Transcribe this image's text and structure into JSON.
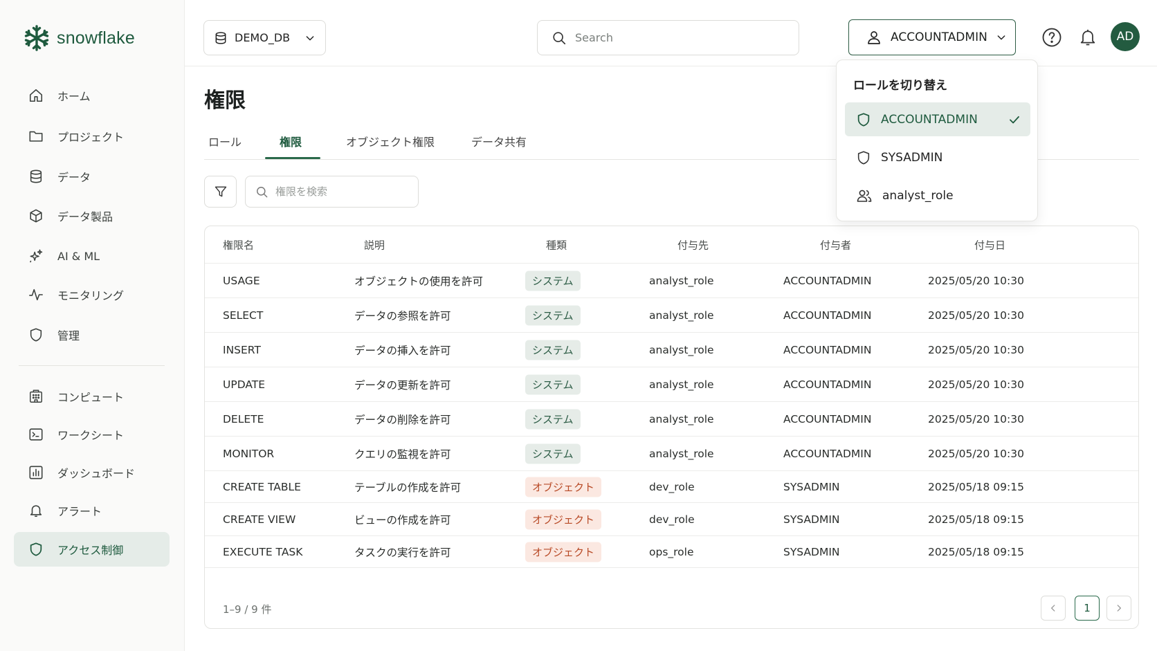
{
  "brand": {
    "name": "snowflake",
    "color": "#29b5e8"
  },
  "colors": {
    "accent": "#1e5a3e",
    "system_badge": "#e6ece8",
    "object_badge": "#fbe8e1"
  },
  "sidebar": {
    "items": [
      {
        "label": "ホーム",
        "icon": "home-icon"
      },
      {
        "label": "プロジェクト",
        "icon": "folder-icon"
      },
      {
        "label": "データ",
        "icon": "database-icon"
      },
      {
        "label": "データ製品",
        "icon": "cube-icon"
      },
      {
        "label": "AI & ML",
        "icon": "sparkle-icon"
      },
      {
        "label": "モニタリング",
        "icon": "activity-icon"
      },
      {
        "label": "管理",
        "icon": "shield-icon"
      },
      {
        "label": "コンピュート",
        "icon": "building-icon"
      },
      {
        "label": "ワークシート",
        "icon": "terminal-icon"
      },
      {
        "label": "ダッシュボード",
        "icon": "chart-icon"
      },
      {
        "label": "アラート",
        "icon": "bell-icon"
      },
      {
        "label": "アクセス制御",
        "icon": "shield-icon",
        "active": true
      }
    ]
  },
  "header": {
    "database": "DEMO_DB",
    "search_placeholder": "Search",
    "role": "ACCOUNTADMIN",
    "avatar_initials": "AD"
  },
  "role_menu": {
    "title": "ロールを切り替え",
    "items": [
      {
        "label": "ACCOUNTADMIN",
        "icon": "shield-icon",
        "selected": true
      },
      {
        "label": "SYSADMIN",
        "icon": "shield-icon",
        "selected": false
      },
      {
        "label": "analyst_role",
        "icon": "users-icon",
        "selected": false
      }
    ]
  },
  "main": {
    "title": "権限",
    "tabs": [
      "ロール",
      "権限",
      "オブジェクト権限",
      "データ共有"
    ],
    "active_tab": "権限",
    "search_placeholder": "権限を検索"
  },
  "table": {
    "columns": [
      "権限名",
      "説明",
      "種類",
      "付与先",
      "付与者",
      "付与日"
    ],
    "rows": [
      [
        "USAGE",
        "オブジェクトの使用を許可",
        "システム",
        "analyst_role",
        "ACCOUNTADMIN",
        "2025/05/20 10:30"
      ],
      [
        "SELECT",
        "データの参照を許可",
        "システム",
        "analyst_role",
        "ACCOUNTADMIN",
        "2025/05/20 10:30"
      ],
      [
        "INSERT",
        "データの挿入を許可",
        "システム",
        "analyst_role",
        "ACCOUNTADMIN",
        "2025/05/20 10:30"
      ],
      [
        "UPDATE",
        "データの更新を許可",
        "システム",
        "analyst_role",
        "ACCOUNTADMIN",
        "2025/05/20 10:30"
      ],
      [
        "DELETE",
        "データの削除を許可",
        "システム",
        "analyst_role",
        "ACCOUNTADMIN",
        "2025/05/20 10:30"
      ],
      [
        "MONITOR",
        "クエリの監視を許可",
        "システム",
        "analyst_role",
        "ACCOUNTADMIN",
        "2025/05/20 10:30"
      ],
      [
        "CREATE TABLE",
        "テーブルの作成を許可",
        "オブジェクト",
        "dev_role",
        "SYSADMIN",
        "2025/05/18 09:15"
      ],
      [
        "CREATE VIEW",
        "ビューの作成を許可",
        "オブジェクト",
        "dev_role",
        "SYSADMIN",
        "2025/05/18 09:15"
      ],
      [
        "EXECUTE TASK",
        "タスクの実行を許可",
        "オブジェクト",
        "ops_role",
        "SYSADMIN",
        "2025/05/18 09:15"
      ]
    ],
    "footer": "1–9 / 9 件",
    "page": "1"
  }
}
